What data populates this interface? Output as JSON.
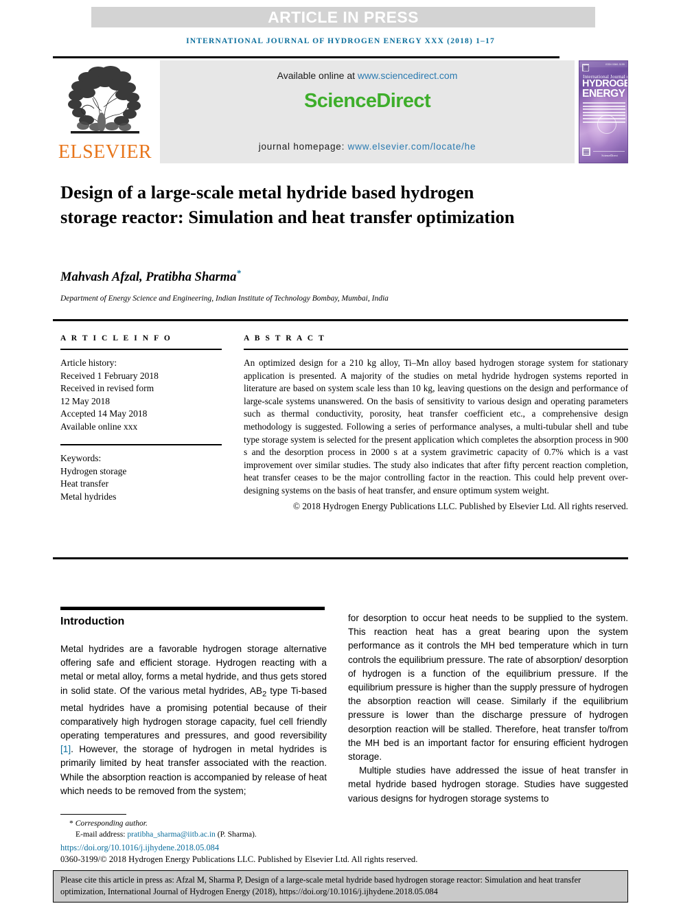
{
  "banner": {
    "article_in_press": "ARTICLE IN PRESS",
    "banner_bg": "#d3d3d3",
    "banner_text_color": "#ffffff"
  },
  "running_head": {
    "text": "INTERNATIONAL JOURNAL OF HYDROGEN ENERGY XXX (2018) 1–17",
    "color": "#0b6e9c"
  },
  "masthead": {
    "publisher_name": "ELSEVIER",
    "publisher_color": "#e8751a",
    "available_prefix": "Available online at ",
    "available_link": "www.sciencedirect.com",
    "sciencedirect_logo": "ScienceDirect",
    "sciencedirect_color": "#3eae2b",
    "homepage_prefix": "journal homepage: ",
    "homepage_link": "www.elsevier.com/locate/he",
    "link_color": "#2a7ab0",
    "cover": {
      "issn": "ISSN 0360-3199",
      "line_small": "International Journal of",
      "line_big_1": "HYDROGEN",
      "line_big_2": "ENERGY",
      "footer": "ScienceDirect"
    }
  },
  "article": {
    "title": "Design of a large-scale metal hydride based hydrogen storage reactor: Simulation and heat transfer optimization",
    "authors": "Mahvash Afzal, Pratibha Sharma",
    "corresponding_marker": "*",
    "affiliation": "Department of Energy Science and Engineering, Indian Institute of Technology Bombay, Mumbai, India"
  },
  "article_info": {
    "section_label": "A R T I C L E   I N F O",
    "history_label": "Article history:",
    "history": [
      "Received 1 February 2018",
      "Received in revised form",
      "12 May 2018",
      "Accepted 14 May 2018",
      "Available online xxx"
    ],
    "keywords_label": "Keywords:",
    "keywords": [
      "Hydrogen storage",
      "Heat transfer",
      "Metal hydrides"
    ]
  },
  "abstract": {
    "section_label": "A B S T R A C T",
    "body": "An optimized design for a 210 kg alloy, Ti–Mn alloy based hydrogen storage system for stationary application is presented. A majority of the studies on metal hydride hydrogen systems reported in literature are based on system scale less than 10 kg, leaving questions on the design and performance of large-scale systems unanswered. On the basis of sensitivity to various design and operating parameters such as thermal conductivity, porosity, heat transfer coefficient etc., a comprehensive design methodology is suggested. Following a series of performance analyses, a multi-tubular shell and tube type storage system is selected for the present application which completes the absorption process in 900 s and the desorption process in 2000 s at a system gravimetric capacity of 0.7% which is a vast improvement over similar studies. The study also indicates that after fifty percent reaction completion, heat transfer ceases to be the major controlling factor in the reaction. This could help prevent over-designing systems on the basis of heat transfer, and ensure optimum system weight.",
    "copyright": "© 2018 Hydrogen Energy Publications LLC. Published by Elsevier Ltd. All rights reserved."
  },
  "body": {
    "intro_heading": "Introduction",
    "left_p1_a": "Metal hydrides are a favorable hydrogen storage alternative offering safe and efficient storage. Hydrogen reacting with a metal or metal alloy, forms a metal hydride, and thus gets stored in solid state. Of the various metal hydrides, AB",
    "left_p1_sub": "2",
    "left_p1_b": " type Ti-based metal hydrides have a promising potential because of their comparatively high hydrogen storage capacity, fuel cell friendly operating temperatures and pressures, and good reversibility ",
    "left_ref": "[1]",
    "left_p1_c": ". However, the storage of hydrogen in metal hydrides is primarily limited by heat transfer associated with the reaction. While the absorption reaction is accompanied by release of heat which needs to be removed from the system;",
    "right_p1": "for desorption to occur heat needs to be supplied to the system. This reaction heat has a great bearing upon the system performance as it controls the MH bed temperature which in turn controls the equilibrium pressure. The rate of absorption/ desorption of hydrogen is a function of the equilibrium pressure. If the equilibrium pressure is higher than the supply pressure of hydrogen the absorption reaction will cease. Similarly if the equilibrium pressure is lower than the discharge pressure of hydrogen desorption reaction will be stalled. Therefore, heat transfer to/from the MH bed is an important factor for ensuring efficient hydrogen storage.",
    "right_p2": "Multiple studies have addressed the issue of heat transfer in metal hydride based hydrogen storage. Studies have suggested various designs for hydrogen storage systems to"
  },
  "footnote": {
    "corresponding_star": "*",
    "corresponding_label": " Corresponding author.",
    "email_label": "E-mail address: ",
    "email": "pratibha_sharma@iitb.ac.in",
    "email_suffix": " (P. Sharma).",
    "doi": "https://doi.org/10.1016/j.ijhydene.2018.05.084",
    "issn_line": "0360-3199/© 2018 Hydrogen Energy Publications LLC. Published by Elsevier Ltd. All rights reserved."
  },
  "cite_box": {
    "text": "Please cite this article in press as: Afzal M, Sharma P, Design of a large-scale metal hydride based hydrogen storage reactor: Simulation and heat transfer optimization, International Journal of Hydrogen Energy (2018), https://doi.org/10.1016/j.ijhydene.2018.05.084"
  }
}
